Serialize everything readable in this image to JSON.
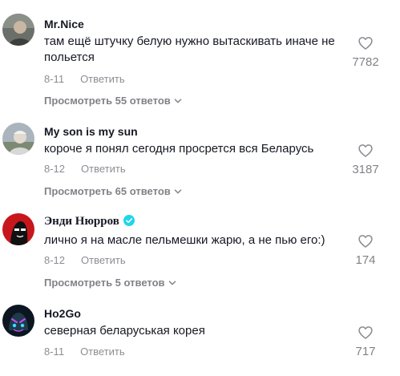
{
  "comments": [
    {
      "username": "Mr.Nice",
      "text": "там ещё штучку белую нужно вытаскивать иначе не польется",
      "date": "8-11",
      "reply_label": "Ответить",
      "likes": "7782",
      "replies_label": "Просмотреть 55 ответов",
      "verified": false
    },
    {
      "username": "My son is my sun",
      "text": "короче я понял сегодня просрется вся Беларусь",
      "date": "8-12",
      "reply_label": "Ответить",
      "likes": "3187",
      "replies_label": "Просмотреть 65 ответов",
      "verified": false
    },
    {
      "username": "Энди Нюрров",
      "text": "лично я на масле пельмешки жарю, а не пью его:)",
      "date": "8-12",
      "reply_label": "Ответить",
      "likes": "174",
      "replies_label": "Просмотреть 5 ответов",
      "verified": true
    },
    {
      "username": "Ho2Go",
      "text": "северная беларуськая корея",
      "date": "8-11",
      "reply_label": "Ответить",
      "likes": "717",
      "verified": false
    }
  ],
  "icons": {
    "like": "heart-outline-icon",
    "expand": "chevron-down-icon",
    "verified": "verified-badge-icon"
  },
  "colors": {
    "text": "#161823",
    "muted": "#8a8b91",
    "verified": "#20d5ec"
  }
}
